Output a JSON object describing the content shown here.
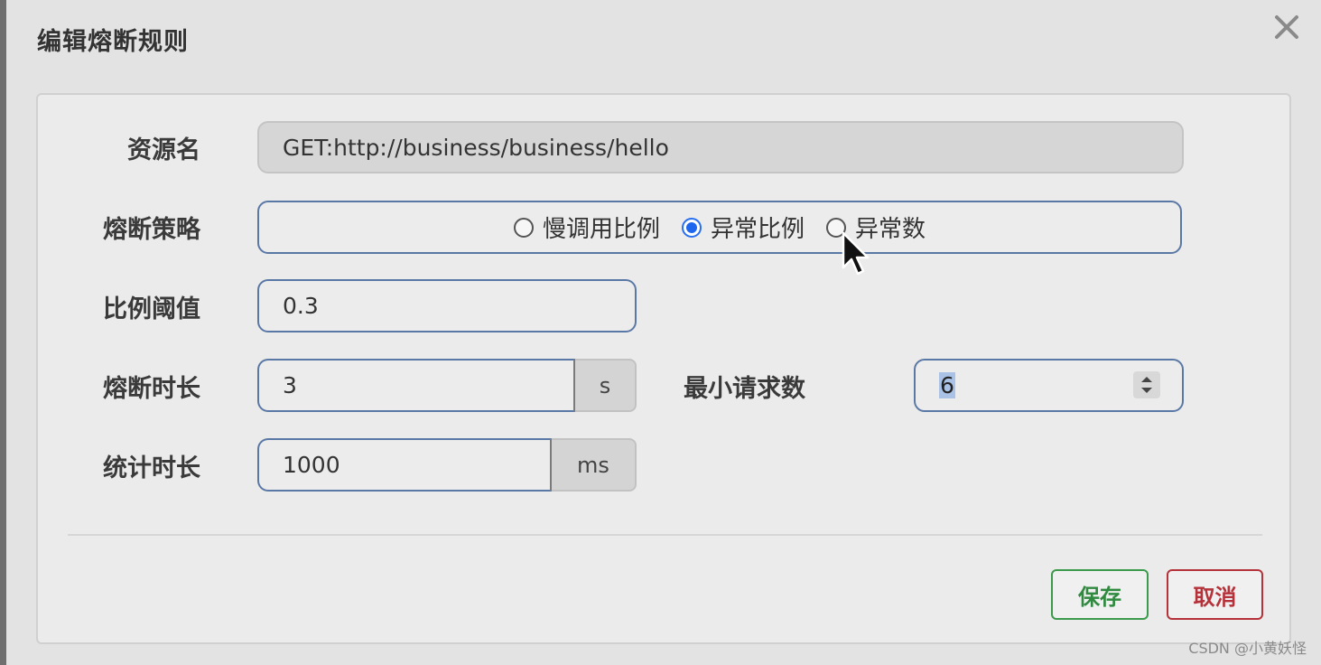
{
  "dialog": {
    "title": "编辑熔断规则",
    "close_icon": "close-icon"
  },
  "form": {
    "resource": {
      "label": "资源名",
      "value": "GET:http://business/business/hello"
    },
    "strategy": {
      "label": "熔断策略",
      "options": [
        {
          "label": "慢调用比例",
          "checked": false
        },
        {
          "label": "异常比例",
          "checked": true
        },
        {
          "label": "异常数",
          "checked": false
        }
      ]
    },
    "ratio_threshold": {
      "label": "比例阈值",
      "value": "0.3"
    },
    "break_duration": {
      "label": "熔断时长",
      "value": "3",
      "unit": "s"
    },
    "min_requests": {
      "label": "最小请求数",
      "value": "6"
    },
    "stat_duration": {
      "label": "统计时长",
      "value": "1000",
      "unit": "ms"
    }
  },
  "buttons": {
    "save": "保存",
    "cancel": "取消"
  },
  "colors": {
    "accent_border": "#5a78a6",
    "radio_checked": "#1f66ef",
    "save": "#2f8a3f",
    "cancel": "#b5323a"
  },
  "watermark": "CSDN @小黄妖怪"
}
